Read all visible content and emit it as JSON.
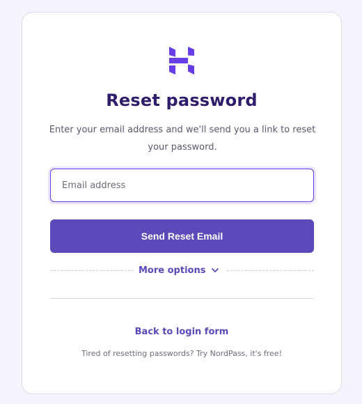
{
  "brand": {
    "logo_icon": "hostinger-h-logo-icon",
    "accent_color": "#673de6",
    "title_color": "#2f1c6a",
    "button_color": "#5b49b9"
  },
  "heading": {
    "title": "Reset password",
    "subtitle": "Enter your email address and we'll send you a link to reset your password."
  },
  "form": {
    "email_placeholder": "Email address",
    "email_value": "",
    "submit_label": "Send Reset Email"
  },
  "more_options": {
    "label": "More options",
    "icon": "chevron-down-icon"
  },
  "footer": {
    "back_link": "Back to login form",
    "note": "Tired of resetting passwords? Try NordPass, it's free!"
  }
}
